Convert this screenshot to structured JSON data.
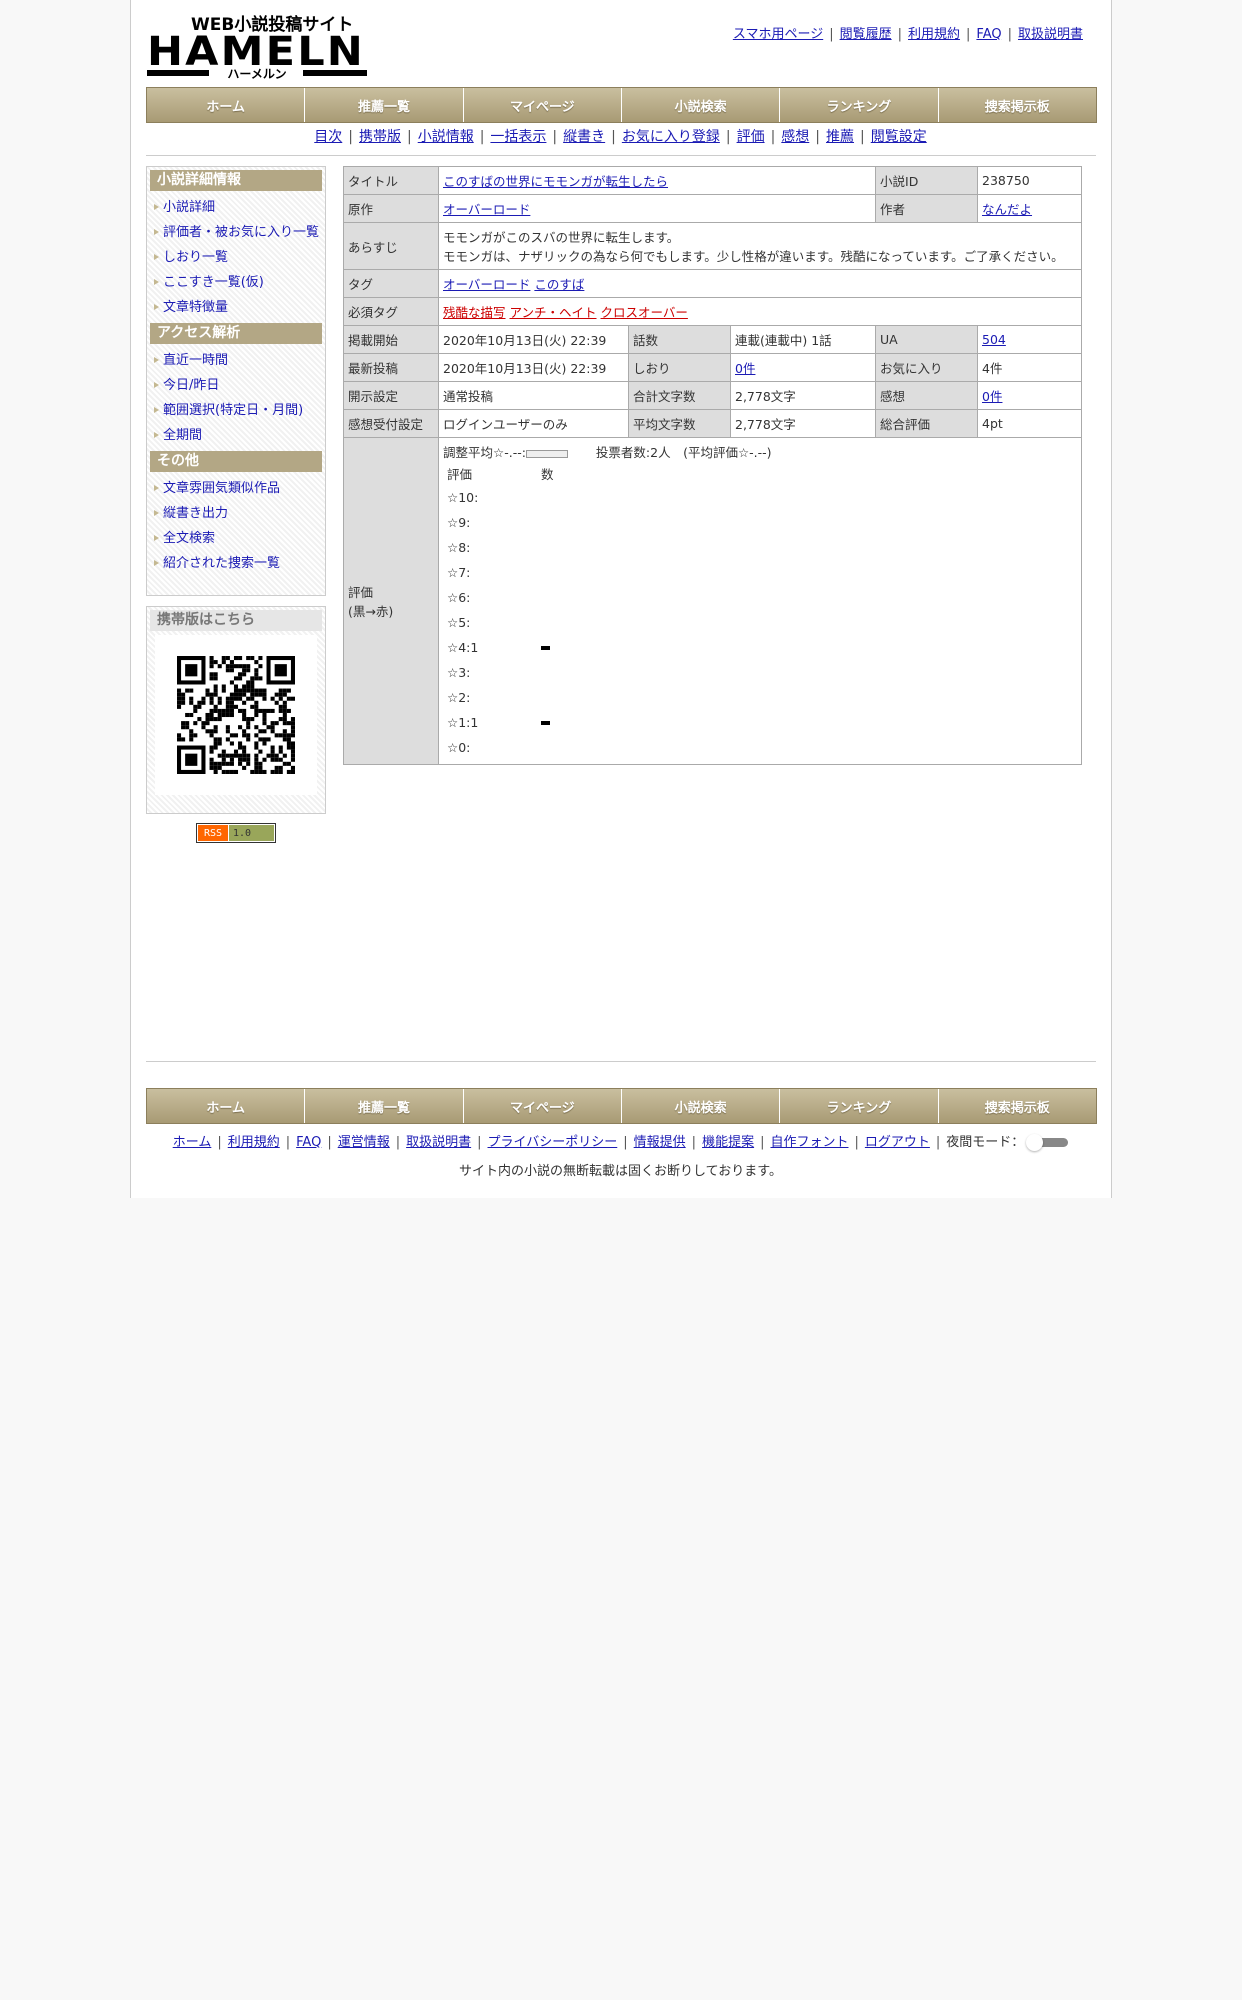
{
  "header": {
    "logo_top": "WEB小説投稿サイト",
    "logo_main": "HAMELN",
    "logo_sub": "ハーメルン",
    "links": [
      "スマホ用ページ",
      "閲覧履歴",
      "利用規約",
      "FAQ",
      "取扱説明書"
    ]
  },
  "nav": [
    "ホーム",
    "推薦一覧",
    "マイページ",
    "小説検索",
    "ランキング",
    "捜索掲示板"
  ],
  "subnav": [
    "目次",
    "携帯版",
    "小説情報",
    "一括表示",
    "縦書き",
    "お気に入り登録",
    "評価",
    "感想",
    "推薦",
    "閲覧設定"
  ],
  "sidebar": {
    "sections": [
      {
        "title": "小説詳細情報",
        "items": [
          "小説詳細",
          "評価者・被お気に入り一覧",
          "しおり一覧",
          "ここすき一覧(仮)",
          "文章特徴量"
        ]
      },
      {
        "title": "アクセス解析",
        "items": [
          "直近一時間",
          "今日/昨日",
          "範囲選択(特定日・月間)",
          "全期間"
        ]
      },
      {
        "title": "その他",
        "items": [
          "文章雰囲気類似作品",
          "縦書き出力",
          "全文検索",
          "紹介された捜索一覧"
        ]
      }
    ],
    "mobile_title": "携帯版はこちら",
    "rss_left": "RSS",
    "rss_right": "1.0"
  },
  "novel": {
    "title_label": "タイトル",
    "title": "このすばの世界にモモンガが転生したら",
    "id_label": "小説ID",
    "id": "238750",
    "original_label": "原作",
    "original": "オーバーロード",
    "author_label": "作者",
    "author": "なんだよ",
    "synopsis_label": "あらすじ",
    "synopsis_1": "モモンガがこのスバの世界に転生します。",
    "synopsis_2": "モモンガは、ナザリックの為なら何でもします。少し性格が違います。残酷になっています。ご了承ください。",
    "tags_label": "タグ",
    "tags": [
      "オーバーロード",
      "このすば"
    ],
    "required_tags_label": "必須タグ",
    "required_tags": [
      "残酷な描写",
      "アンチ・ヘイト",
      "クロスオーバー"
    ],
    "start_label": "掲載開始",
    "start": "2020年10月13日(火) 22:39",
    "episodes_label": "話数",
    "episodes": "連載(連載中) 1話",
    "ua_label": "UA",
    "ua": "504",
    "latest_label": "最新投稿",
    "latest": "2020年10月13日(火) 22:39",
    "bookmarks_label": "しおり",
    "bookmarks": "0件",
    "favorites_label": "お気に入り",
    "favorites": "4件",
    "disclosure_label": "開示設定",
    "disclosure": "通常投稿",
    "total_chars_label": "合計文字数",
    "total_chars": "2,778文字",
    "comments_label": "感想",
    "comments": "0件",
    "comment_setting_label": "感想受付設定",
    "comment_setting": "ログインユーザーのみ",
    "avg_chars_label": "平均文字数",
    "avg_chars": "2,778文字",
    "total_eval_label": "総合評価",
    "total_eval": "4pt",
    "eval_label_1": "評価",
    "eval_label_2": "(黒→赤)",
    "eval_avg": "調整平均☆-.--:",
    "eval_votes": "投票者数:2人　(平均評価☆-.--)",
    "eval_col_score": "評価",
    "eval_col_count": "数",
    "eval_rows": [
      {
        "label": "☆10:",
        "count": 0
      },
      {
        "label": "☆9:",
        "count": 0
      },
      {
        "label": "☆8:",
        "count": 0
      },
      {
        "label": "☆7:",
        "count": 0
      },
      {
        "label": "☆6:",
        "count": 0
      },
      {
        "label": "☆5:",
        "count": 0
      },
      {
        "label": "☆4:1",
        "count": 1
      },
      {
        "label": "☆3:",
        "count": 0
      },
      {
        "label": "☆2:",
        "count": 0
      },
      {
        "label": "☆1:1",
        "count": 1
      },
      {
        "label": "☆0:",
        "count": 0
      }
    ]
  },
  "footer": {
    "links": [
      "ホーム",
      "利用規約",
      "FAQ",
      "運営情報",
      "取扱説明書",
      "プライバシーポリシー",
      "情報提供",
      "機能提案",
      "自作フォント",
      "ログアウト"
    ],
    "night_mode": "夜間モード：",
    "notice": "サイト内の小説の無断転載は固くお断りしております。"
  }
}
